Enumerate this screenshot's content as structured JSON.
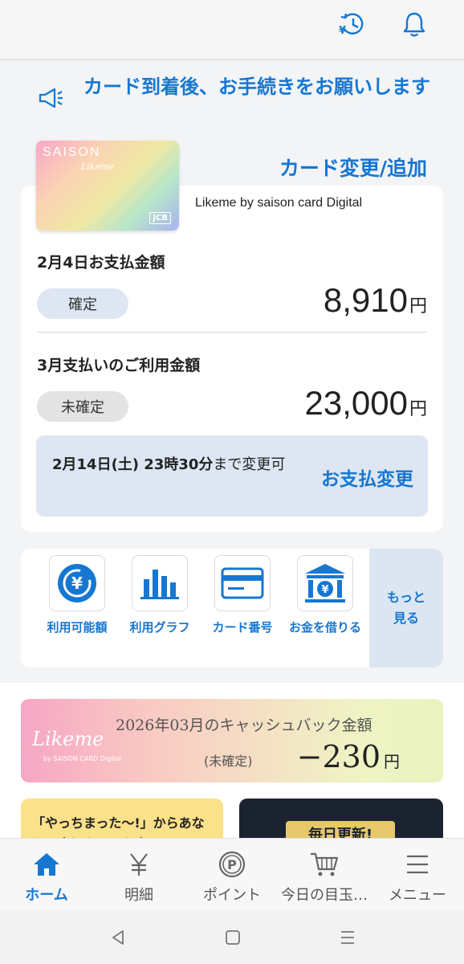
{
  "header": {
    "icons": [
      "yen-history-icon",
      "bell-icon"
    ]
  },
  "notice": {
    "text": "カード到着後、お手続きをお願いします",
    "icon": "megaphone-icon"
  },
  "card": {
    "change_link": "カード変更/追加",
    "brand": "SAISON",
    "script": "Likeme",
    "network": "JCB",
    "name": "Likeme by saison card Digital"
  },
  "payment1": {
    "title": "2月4日お支払金額",
    "status": "確定",
    "amount": "8,910",
    "unit": "円"
  },
  "payment2": {
    "title": "3月支払いのご利用金額",
    "status": "未確定",
    "amount": "23,000",
    "unit": "円"
  },
  "change": {
    "deadline_bold": "2月14日(土) 23時30分",
    "deadline_rest": "まで変更可",
    "link": "お支払変更"
  },
  "quick_actions": [
    {
      "label": "利用可能額",
      "icon": "yen-coin-icon"
    },
    {
      "label": "利用グラフ",
      "icon": "bar-chart-icon"
    },
    {
      "label": "カード番号",
      "icon": "credit-card-icon"
    },
    {
      "label": "お金を借りる",
      "icon": "bank-icon"
    }
  ],
  "more": {
    "label": "もっと見る"
  },
  "cashback": {
    "logo": "Likeme",
    "sub": "by SAISON CARD Digital",
    "title": "2026年03月のキャッシュバック金額",
    "status": "(未確定)",
    "amount": "−230",
    "unit": "円"
  },
  "promos": {
    "left": "「やっちまった〜!」からあなたの大切なモノを守る",
    "right": "毎日更新!"
  },
  "bottom_nav": [
    {
      "label": "ホーム",
      "icon": "home-icon",
      "active": true
    },
    {
      "label": "明細",
      "icon": "yen-icon"
    },
    {
      "label": "ポイント",
      "icon": "point-icon"
    },
    {
      "label": "今日の目玉…",
      "icon": "cart-icon"
    },
    {
      "label": "メニュー",
      "icon": "menu-icon"
    }
  ],
  "colors": {
    "accent": "#1677d2",
    "confirmed_pill": "#dde6f2",
    "unconfirmed_pill": "#e3e3e3"
  }
}
